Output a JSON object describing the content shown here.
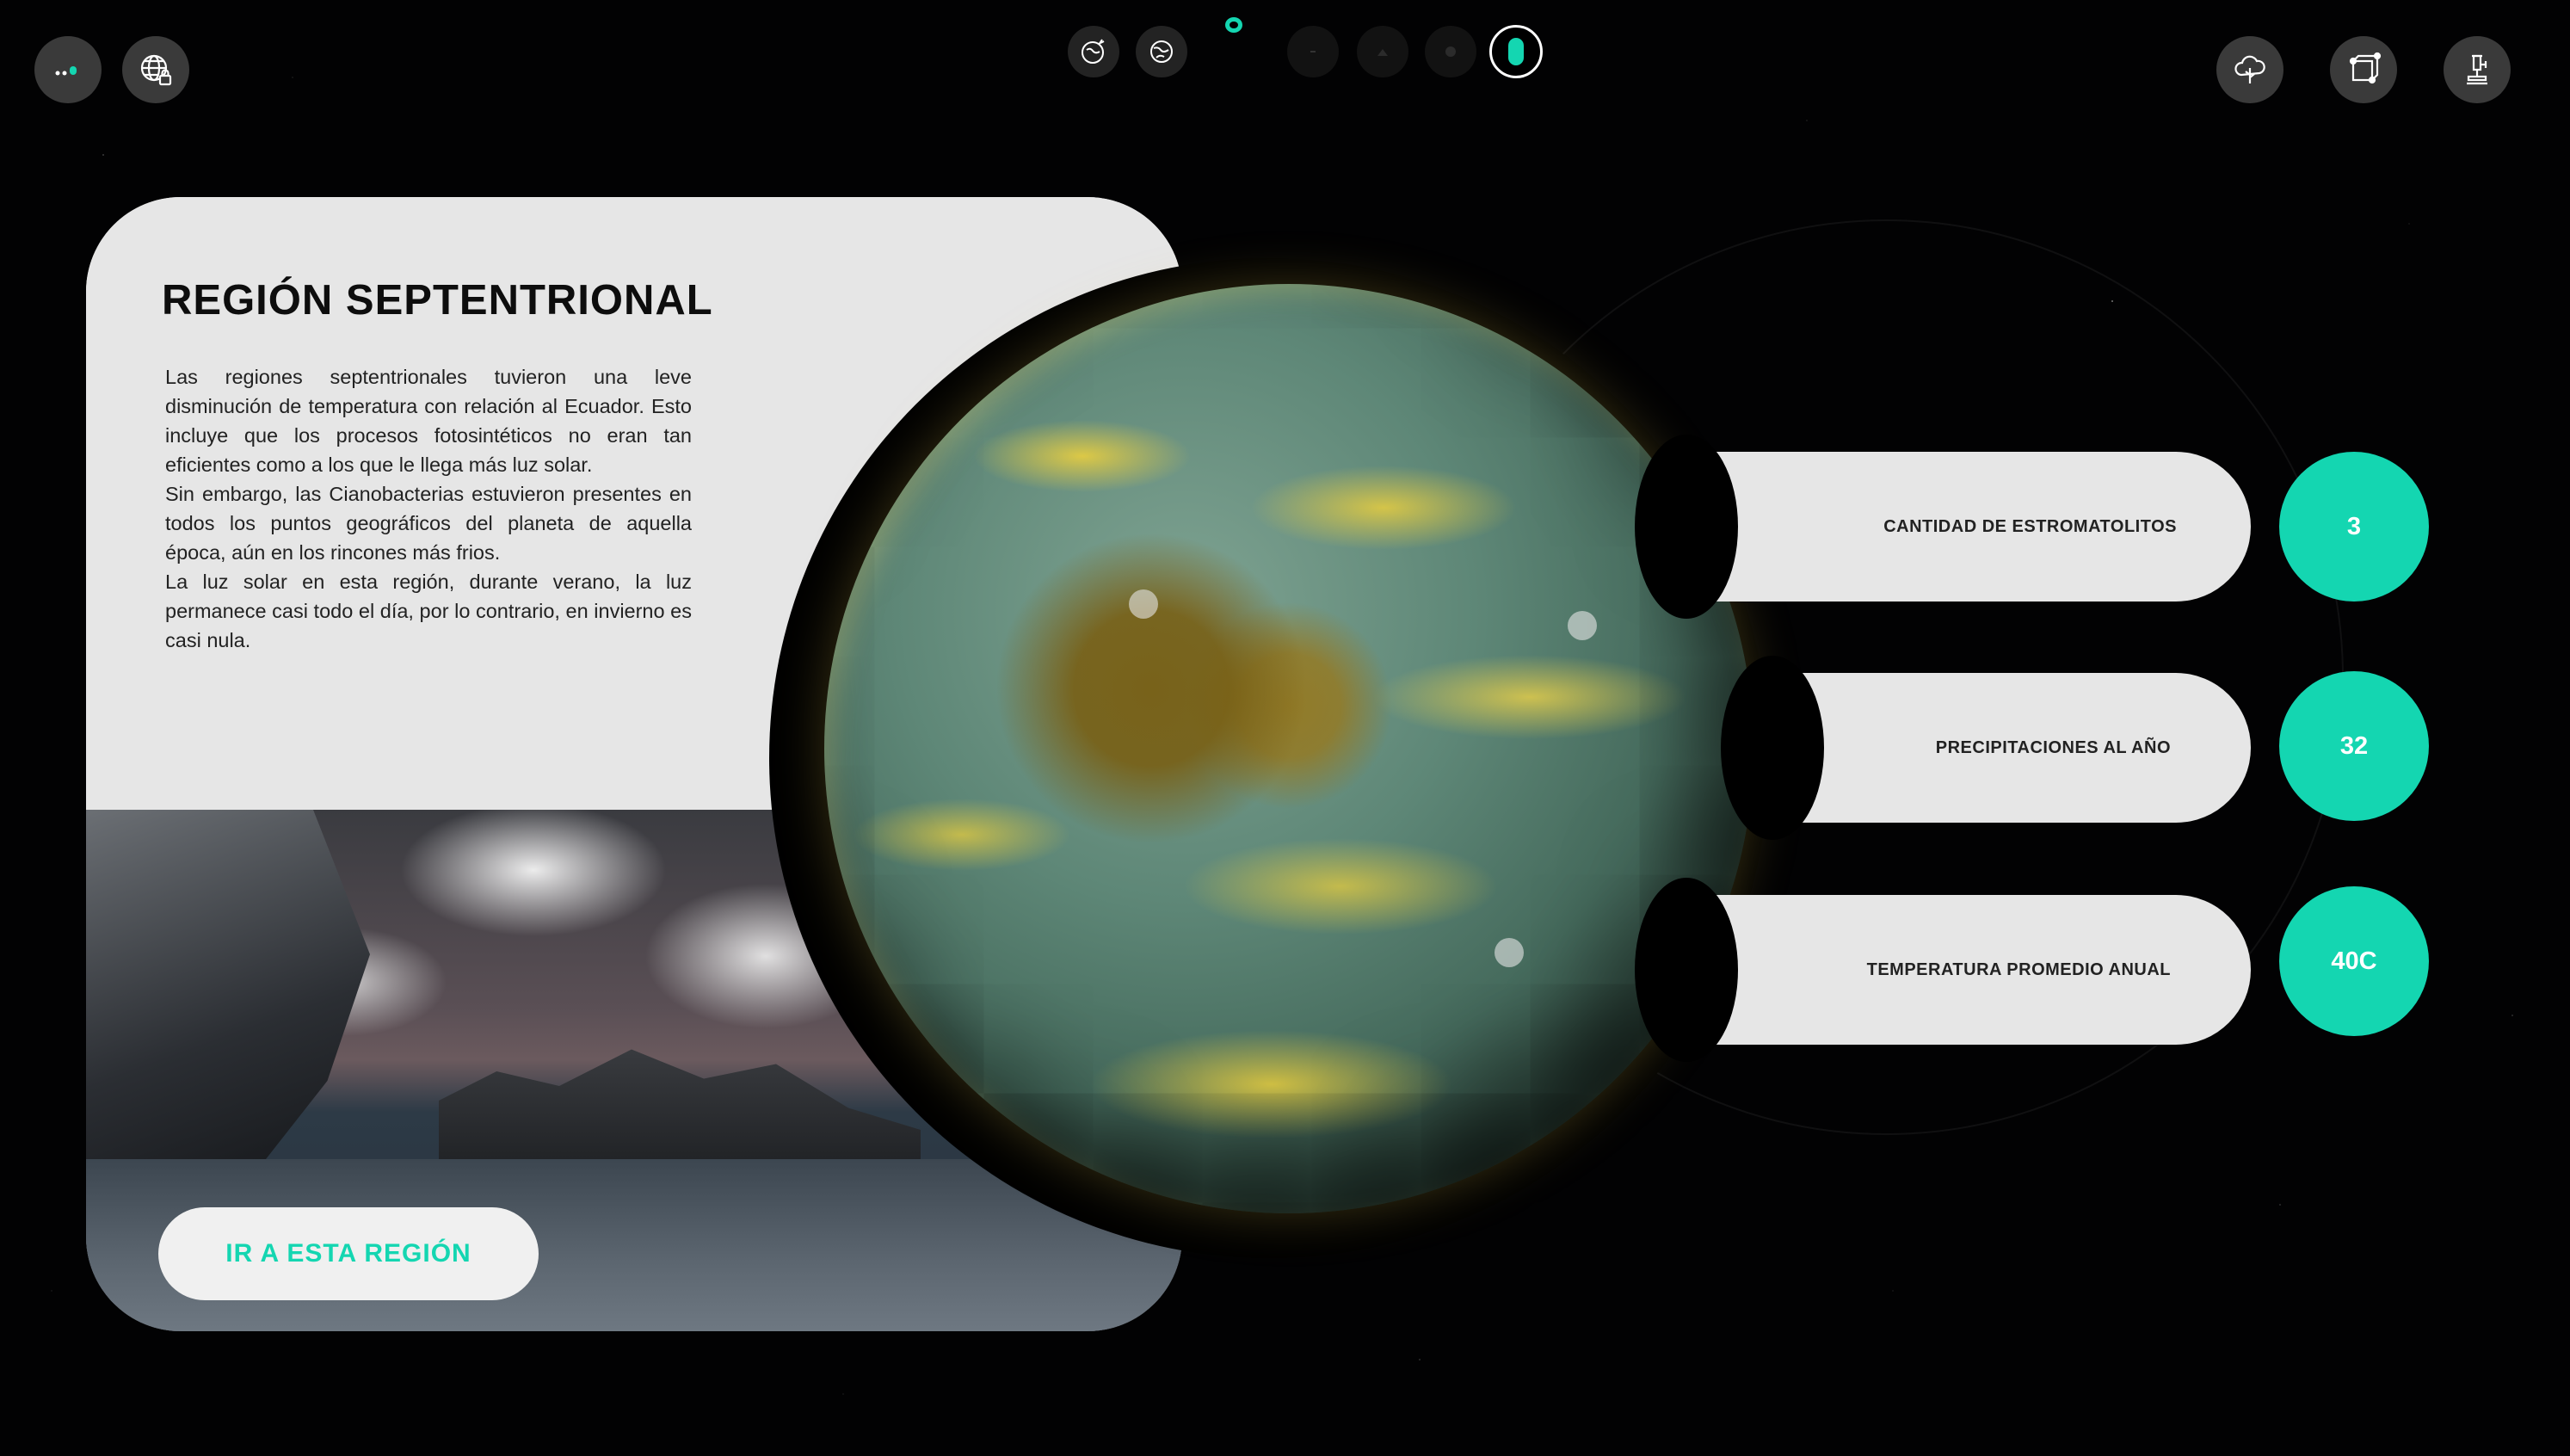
{
  "top_left": {
    "status_icon": "signal-dots-icon",
    "globe_icon": "globe-lock-icon"
  },
  "top_center": {
    "nav_icons": [
      "earth-plant-icon",
      "earth-globe-icon",
      "step-dot-icon",
      "step-dot-icon",
      "step-dot-icon",
      "active-step-icon"
    ],
    "accent": "#14d6b1"
  },
  "top_right": {
    "icons": [
      "cloud-tree-icon",
      "cube-network-icon",
      "microscope-icon"
    ]
  },
  "region": {
    "title": "REGIÓN SEPTENTRIONAL",
    "paragraphs": [
      "Las regiones septentrionales tuvieron una leve disminución de temperatura con relación al Ecuador. Esto incluye que los procesos fotosintéticos no eran tan eficientes como a los que le llega más luz solar.",
      "Sin embargo, las Cianobacterias estuvieron presentes en todos los puntos geográficos del planeta de aquella época, aún en los rincones más frios.",
      "La luz solar en esta región, durante verano, la luz permanece casi todo el día, por lo contrario, en invierno es casi nula."
    ],
    "button_label": "IR A ESTA REGIÓN"
  },
  "stats": [
    {
      "label": "CANTIDAD DE ESTROMATOLITOS",
      "value": "3"
    },
    {
      "label": "PRECIPITACIONES AL AÑO",
      "value": "32"
    },
    {
      "label": "TEMPERATURA PROMEDIO ANUAL",
      "value": "40C"
    }
  ],
  "colors": {
    "accent": "#14d6b1",
    "card_bg": "#e6e6e6",
    "background": "#000000"
  }
}
